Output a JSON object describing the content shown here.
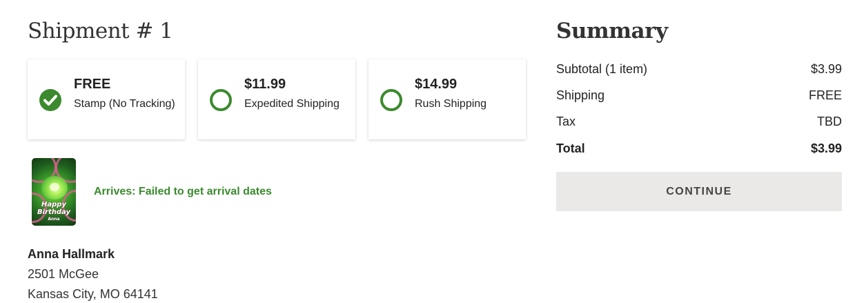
{
  "shipment": {
    "title": "Shipment # 1",
    "options": [
      {
        "price": "FREE",
        "description": "Stamp (No Tracking)",
        "selected": true
      },
      {
        "price": "$11.99",
        "description": "Expedited Shipping",
        "selected": false
      },
      {
        "price": "$14.99",
        "description": "Rush Shipping",
        "selected": false
      }
    ],
    "product": {
      "thumbnail_text_line1": "Happy",
      "thumbnail_text_line2": "Birthday",
      "thumbnail_text_line3": "Anna",
      "arrives": "Arrives: Failed to get arrival dates"
    },
    "address": {
      "name": "Anna Hallmark",
      "street": "2501 McGee",
      "city_state_zip": "Kansas City, MO 64141"
    }
  },
  "summary": {
    "title": "Summary",
    "rows": [
      {
        "label": "Subtotal (1 item)",
        "value": "$3.99"
      },
      {
        "label": "Shipping",
        "value": "FREE"
      },
      {
        "label": "Tax",
        "value": "TBD"
      }
    ],
    "total": {
      "label": "Total",
      "value": "$3.99"
    },
    "continue_label": "CONTINUE"
  },
  "colors": {
    "accent_green": "#3b8a2e",
    "button_bg": "#ebe9e7"
  },
  "icons": {
    "selected_option": "check-circle-icon",
    "unselected_option": "radio-circle-icon"
  }
}
